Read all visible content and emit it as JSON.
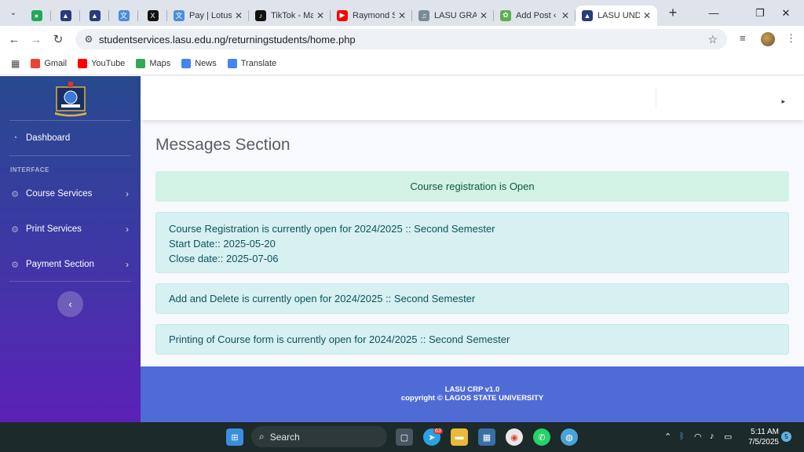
{
  "browser": {
    "tabs": [
      {
        "label": "",
        "favicon": "green-icon"
      },
      {
        "label": "",
        "favicon": "lasu-icon"
      },
      {
        "label": "",
        "favicon": "lasu-icon"
      },
      {
        "label": "",
        "favicon": "translate-icon"
      },
      {
        "label": "",
        "favicon": "x-icon"
      },
      {
        "label": "Pay | Lotus",
        "favicon": "translate-icon"
      },
      {
        "label": "TikTok - Ma",
        "favicon": "tiktok-icon"
      },
      {
        "label": "Raymond S",
        "favicon": "youtube-icon"
      },
      {
        "label": "LASU GRAN",
        "favicon": "mic-icon"
      },
      {
        "label": "Add Post ‹",
        "favicon": "leaf-icon"
      },
      {
        "label": "LASU UNDI",
        "favicon": "lasu-icon"
      }
    ],
    "url": "studentservices.lasu.edu.ng/returningstudents/home.php",
    "bookmarks": [
      {
        "label": "Gmail",
        "color": "#ea4335"
      },
      {
        "label": "YouTube",
        "color": "#ff0000"
      },
      {
        "label": "Maps",
        "color": "#34a853"
      },
      {
        "label": "News",
        "color": "#4285f4"
      },
      {
        "label": "Translate",
        "color": "#4285f4"
      }
    ]
  },
  "sidebar": {
    "dashboard": "Dashboard",
    "heading": "INTERFACE",
    "items": [
      {
        "label": "Course Services"
      },
      {
        "label": "Print Services"
      },
      {
        "label": "Payment Section"
      }
    ],
    "collapse_icon": "‹"
  },
  "main": {
    "title": "Messages Section",
    "status": "Course registration is Open",
    "registration": {
      "line1": "Course Registration is currently open for 2024/2025 :: Second Semester",
      "line2": "Start Date:: 2025-05-20",
      "line3": "Close date:: 2025-07-06"
    },
    "add_delete": "Add and Delete is currently open for 2024/2025 :: Second Semester",
    "printing": "Printing of Course form is currently open for 2024/2025 :: Second Semester"
  },
  "footer": {
    "version": "LASU CRP v1.0",
    "copyright": "copyright © LAGOS STATE UNIVERSITY"
  },
  "taskbar": {
    "search": "Search",
    "telegram_badge": "63",
    "time": "5:11 AM",
    "date": "7/5/2025",
    "notifications": "5"
  },
  "colors": {
    "sidebar_top": "#274a8e",
    "sidebar_bottom": "#5b21b6",
    "footer": "#4f6bd6",
    "success_bg": "#d1f2e5",
    "info_bg": "#d7f0f2"
  }
}
